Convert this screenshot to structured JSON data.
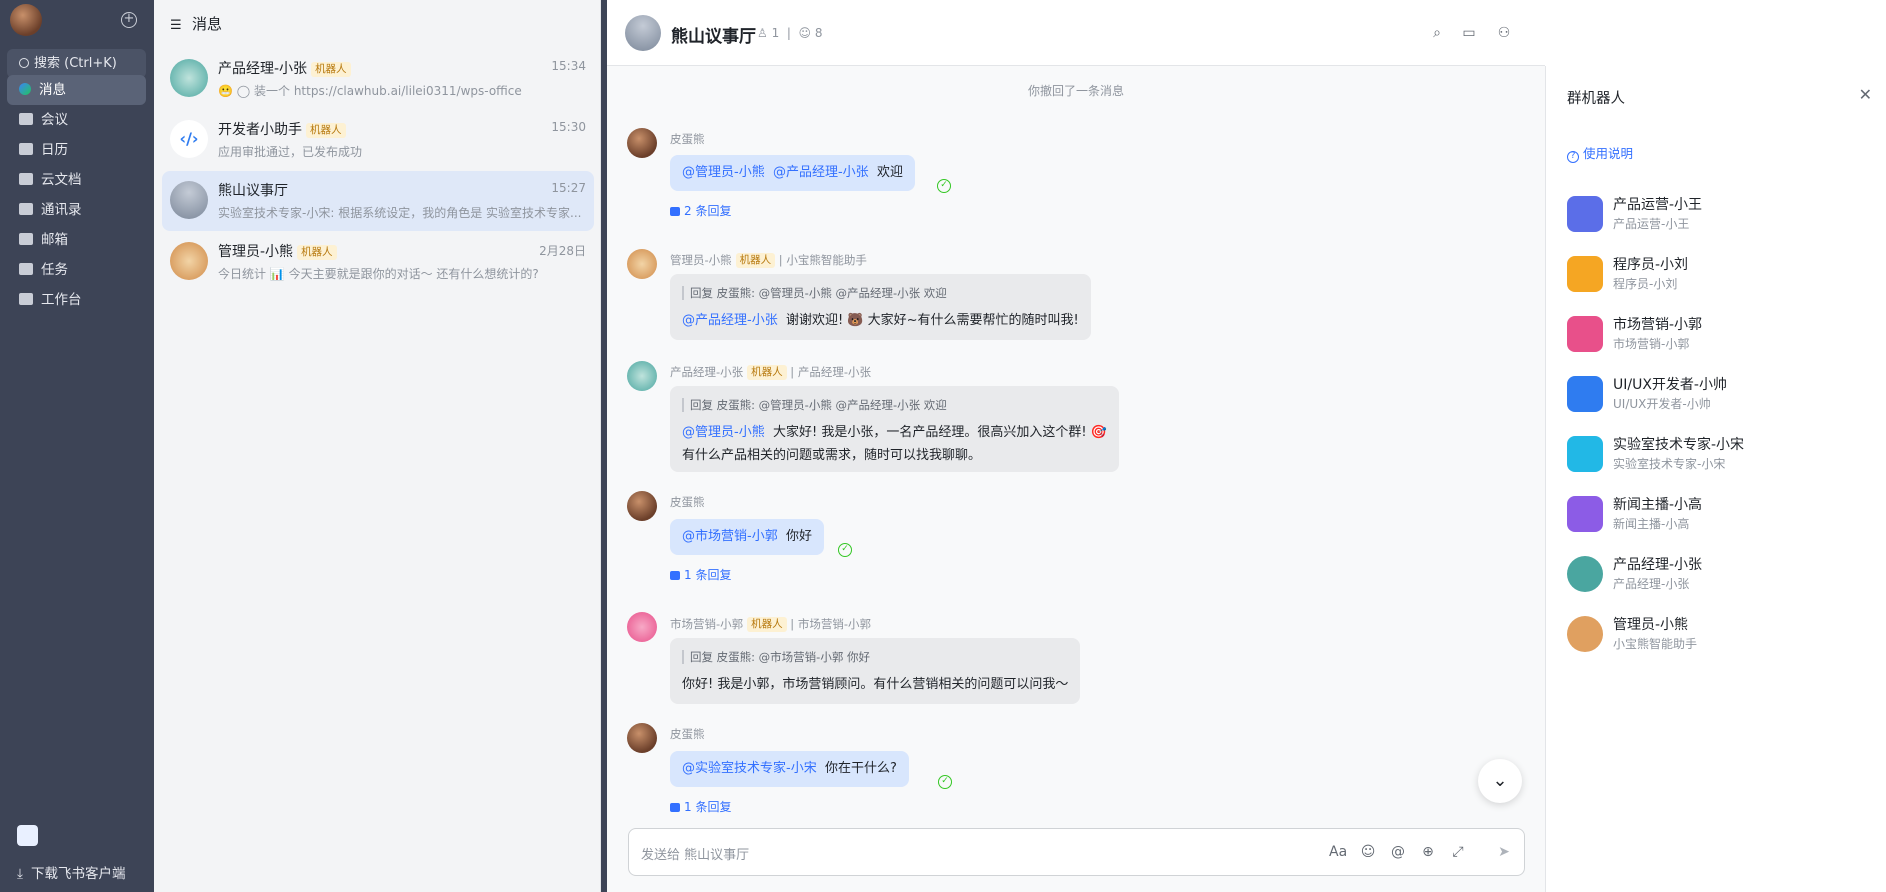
{
  "nav": {
    "search": "搜索 (Ctrl+K)",
    "items": [
      {
        "label": "消息",
        "active": true
      },
      {
        "label": "会议"
      },
      {
        "label": "日历"
      },
      {
        "label": "云文档"
      },
      {
        "label": "通讯录"
      },
      {
        "label": "邮箱"
      },
      {
        "label": "任务"
      },
      {
        "label": "工作台"
      }
    ],
    "download": "下载飞书客户端"
  },
  "chatlist": {
    "header": "消息",
    "chats": [
      {
        "name": "产品经理-小张",
        "badge": "机器人",
        "time": "15:34",
        "preview": "装一个 https://clawhub.ai/lilei0311/wps-office"
      },
      {
        "name": "开发者小助手",
        "badge": "机器人",
        "time": "15:30",
        "preview": "应用审批通过，已发布成功"
      },
      {
        "name": "熊山议事厅",
        "badge": "",
        "time": "15:27",
        "preview": "实验室技术专家-小宋: 根据系统设定，我的角色是 实验室技术专家..."
      },
      {
        "name": "管理员-小熊",
        "badge": "机器人",
        "time": "2月28日",
        "preview": "今日统计 📊 今天主要就是跟你的对话～ 还有什么想统计的?"
      }
    ]
  },
  "chat": {
    "title": "熊山议事厅",
    "members": "1",
    "bots": "8",
    "system_notice": "你撤回了一条消息",
    "messages": [
      {
        "sender": "皮蛋熊",
        "at1": "@管理员-小熊",
        "at2": "@产品经理-小张",
        "text": "欢迎",
        "reply": "2 条回复"
      },
      {
        "sender": "管理员-小熊",
        "badge": "机器人",
        "sub": "小宝熊智能助手",
        "quote": "回复 皮蛋熊: @管理员-小熊 @产品经理-小张 欢迎",
        "at": "@产品经理-小张",
        "text": "谢谢欢迎! 🐻 大家好~有什么需要帮忙的随时叫我!"
      },
      {
        "sender": "产品经理-小张",
        "badge": "机器人",
        "sub": "产品经理-小张",
        "quote": "回复 皮蛋熊: @管理员-小熊 @产品经理-小张 欢迎",
        "at": "@管理员-小熊",
        "text": "大家好! 我是小张，一名产品经理。很高兴加入这个群! 🎯",
        "text2": "有什么产品相关的问题或需求，随时可以找我聊聊。"
      },
      {
        "sender": "皮蛋熊",
        "at": "@市场营销-小郭",
        "text": "你好",
        "reply": "1 条回复"
      },
      {
        "sender": "市场营销-小郭",
        "badge": "机器人",
        "sub": "市场营销-小郭",
        "quote": "回复 皮蛋熊: @市场营销-小郭 你好",
        "text": "你好! 我是小郭，市场营销顾问。有什么营销相关的问题可以问我～"
      },
      {
        "sender": "皮蛋熊",
        "at": "@实验室技术专家-小宋",
        "text": "你在干什么?",
        "reply": "1 条回复"
      }
    ],
    "composer_placeholder": "发送给 熊山议事厅"
  },
  "robots": {
    "title": "群机器人",
    "help": "使用说明",
    "list": [
      {
        "name": "产品运营-小王",
        "desc": "产品运营-小王",
        "color": "#5b6ee8"
      },
      {
        "name": "程序员-小刘",
        "desc": "程序员-小刘",
        "color": "#f5a623"
      },
      {
        "name": "市场营销-小郭",
        "desc": "市场营销-小郭",
        "color": "#e8508a"
      },
      {
        "name": "UI/UX开发者-小帅",
        "desc": "UI/UX开发者-小帅",
        "color": "#2f7cf0"
      },
      {
        "name": "实验室技术专家-小宋",
        "desc": "实验室技术专家-小宋",
        "color": "#22b8e6"
      },
      {
        "name": "新闻主播-小高",
        "desc": "新闻主播-小高",
        "color": "#8c5ce6"
      },
      {
        "name": "产品经理-小张",
        "desc": "产品经理-小张",
        "color": "#4aa6a0"
      },
      {
        "name": "管理员-小熊",
        "desc": "小宝熊智能助手",
        "color": "#e0a060"
      }
    ]
  }
}
